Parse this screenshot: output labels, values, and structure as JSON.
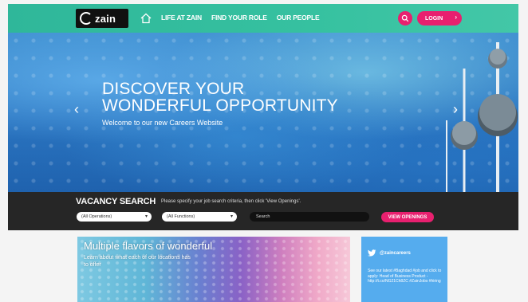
{
  "header": {
    "logo_text": "zain",
    "nav": [
      "LIFE AT ZAIN",
      "FIND YOUR ROLE",
      "OUR PEOPLE"
    ],
    "login_label": "LOGIN",
    "accent_color": "#e8206f",
    "bar_color": "#2fb79a"
  },
  "hero": {
    "title_line1": "DISCOVER YOUR",
    "title_line2": "WONDERFUL OPPORTUNITY",
    "subtitle": "Welcome to our new Careers Website"
  },
  "vacancy": {
    "title": "VACANCY SEARCH",
    "hint": "Please specify your job search criteria, then click 'View Openings'.",
    "operations_value": "(All Operations)",
    "functions_value": "(All Functions)",
    "search_placeholder": "Search",
    "button_label": "VIEW OPENINGS"
  },
  "promo": {
    "title": "Multiple flavors of wonderful",
    "subtitle": "Learn about what each of our locations has to offer"
  },
  "twitter": {
    "handle": "@zaincareers",
    "tweet": "See our latest #Baghdad #job and click to apply: Head of Business Product - http://t.co/NG21Ch8ZC #ZainJobs #hiring"
  },
  "icons": {
    "home": "home-icon",
    "search": "search-icon",
    "twitter": "twitter-bird-icon"
  }
}
